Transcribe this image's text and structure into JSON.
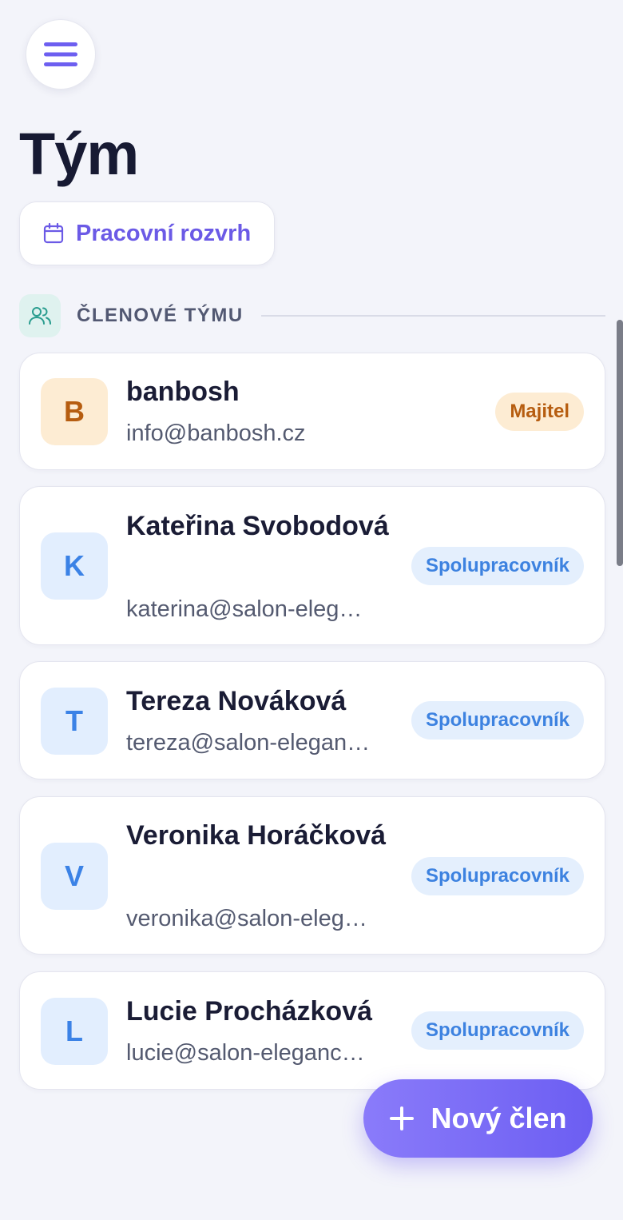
{
  "header": {
    "menu_icon": "hamburger-menu-icon",
    "title": "Tým"
  },
  "schedule_button": {
    "icon": "calendar-icon",
    "label": "Pracovní rozvrh"
  },
  "section": {
    "icon": "users-icon",
    "title": "ČLENOVÉ TÝMU"
  },
  "members": [
    {
      "initial": "B",
      "name": "banbosh",
      "email": "info@banbosh.cz",
      "role": "Majitel"
    },
    {
      "initial": "K",
      "name": "Kateřina Svobodová",
      "email": "katerina@salon-eleg…",
      "role": "Spolupracovník"
    },
    {
      "initial": "T",
      "name": "Tereza Nováková",
      "email": "tereza@salon-elegan…",
      "role": "Spolupracovník"
    },
    {
      "initial": "V",
      "name": "Veronika Horáčková",
      "email": "veronika@salon-eleg…",
      "role": "Spolupracovník"
    },
    {
      "initial": "L",
      "name": "Lucie Procházková",
      "email": "lucie@salon-eleganc…",
      "role": "Spolupracovník"
    }
  ],
  "fab": {
    "icon": "plus-icon",
    "label": "Nový člen"
  },
  "colors": {
    "accent": "#6c5ef2",
    "owner_badge_bg": "#fdecd3",
    "owner_badge_text": "#b65d10",
    "staff_badge_bg": "#e4effd",
    "staff_badge_text": "#3d82e0",
    "section_icon_bg": "#dff2ef",
    "background": "#f3f4fa"
  }
}
